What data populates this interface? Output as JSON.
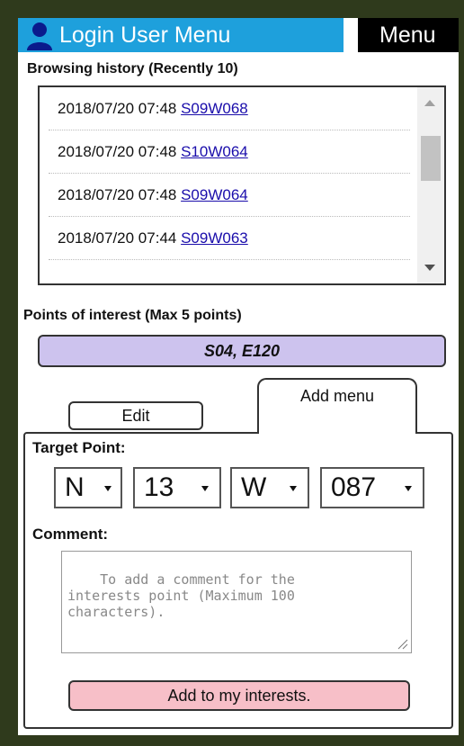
{
  "header": {
    "title": "Login User Menu",
    "menu_label": "Menu",
    "accent_color": "#1ea0dc"
  },
  "history": {
    "label": "Browsing history (Recently 10)",
    "items": [
      {
        "time": "2018/07/20 07:48",
        "code": "S09W068"
      },
      {
        "time": "2018/07/20 07:48",
        "code": "S10W064"
      },
      {
        "time": "2018/07/20 07:48",
        "code": "S09W064"
      },
      {
        "time": "2018/07/20 07:44",
        "code": "S09W063"
      }
    ]
  },
  "poi": {
    "label": "Points of interest (Max 5 points)",
    "value": "S04, E120",
    "color": "#cdc3ee"
  },
  "tabs": {
    "edit": "Edit",
    "add_menu": "Add menu"
  },
  "form": {
    "target_label": "Target Point:",
    "lat_dir": "N",
    "lat_val": "13",
    "lon_dir": "W",
    "lon_val": "087",
    "comment_label": "Comment:",
    "comment_placeholder": "To add a comment for the\ninterests point (Maximum 100\ncharacters).",
    "submit_label": "Add to my interests.",
    "submit_color": "#f7bfc8"
  }
}
